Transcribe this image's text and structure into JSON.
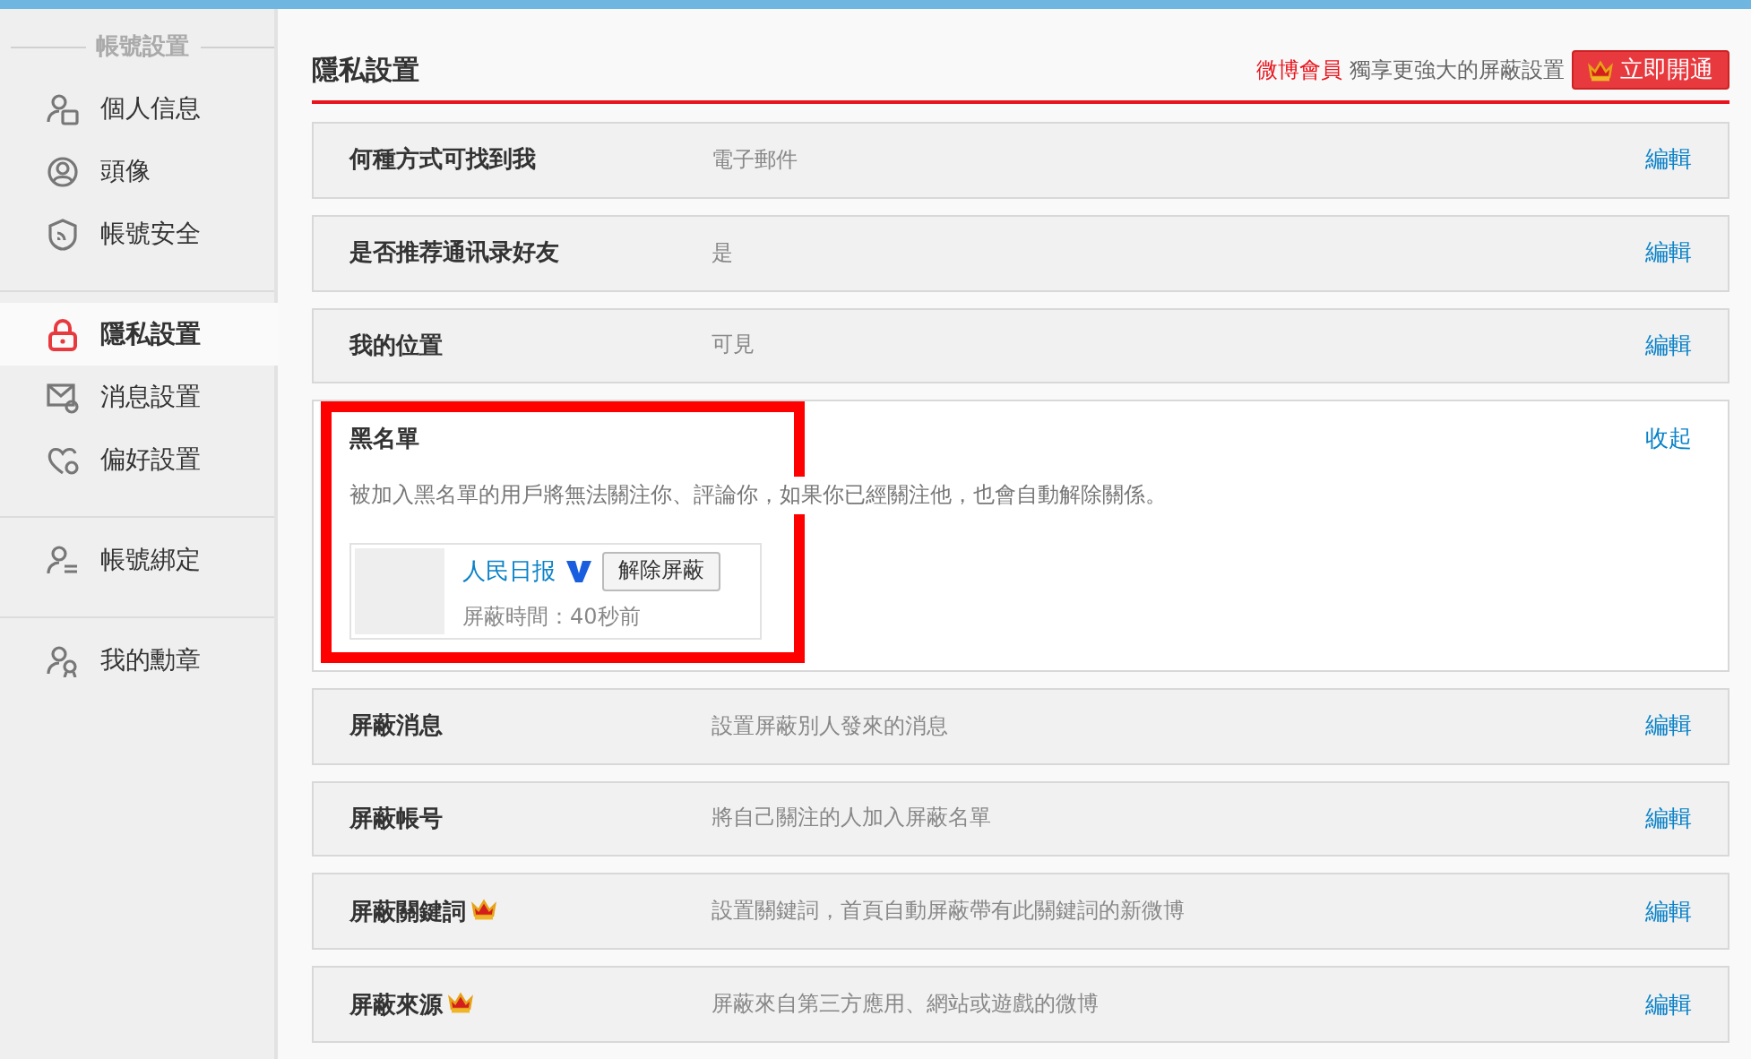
{
  "sidebar": {
    "heading": "帳號設置",
    "groups": [
      {
        "items": [
          {
            "label": "個人信息",
            "selected": false
          },
          {
            "label": "頭像",
            "selected": false
          },
          {
            "label": "帳號安全",
            "selected": false
          }
        ]
      },
      {
        "items": [
          {
            "label": "隱私設置",
            "selected": true
          },
          {
            "label": "消息設置",
            "selected": false
          },
          {
            "label": "偏好設置",
            "selected": false
          }
        ]
      },
      {
        "items": [
          {
            "label": "帳號綁定",
            "selected": false
          }
        ]
      },
      {
        "items": [
          {
            "label": "我的勳章",
            "selected": false
          }
        ]
      }
    ]
  },
  "header": {
    "title": "隱私設置",
    "promo_brand": "微博會員",
    "promo_text": "獨享更強大的屏蔽設置",
    "promo_button": "立即開通"
  },
  "rows_top": [
    {
      "label": "何種方式可找到我",
      "value": "電子郵件",
      "action": "編輯",
      "vip": false
    },
    {
      "label": "是否推荐通讯录好友",
      "value": "是",
      "action": "編輯",
      "vip": false
    },
    {
      "label": "我的位置",
      "value": "可見",
      "action": "編輯",
      "vip": false
    }
  ],
  "blacklist": {
    "title": "黑名單",
    "action": "收起",
    "description": "被加入黑名單的用戶將無法關注你、評論你，如果你已經關注他，也會自動解除關係。",
    "entries": [
      {
        "name": "人民日报",
        "verified": true,
        "button": "解除屏蔽",
        "time_label": "屏蔽時間：",
        "time": "40秒前"
      }
    ]
  },
  "rows_bottom": [
    {
      "label": "屏蔽消息",
      "value": "設置屏蔽別人發來的消息",
      "action": "編輯",
      "vip": false
    },
    {
      "label": "屏蔽帳号",
      "value": "將自己關注的人加入屏蔽名單",
      "action": "編輯",
      "vip": false
    },
    {
      "label": "屏蔽關鍵詞",
      "value": "設置關鍵詞，首頁自動屏蔽帶有此關鍵詞的新微博",
      "action": "編輯",
      "vip": true
    },
    {
      "label": "屏蔽來源",
      "value": "屏蔽來自第三方應用、網站或遊戲的微博",
      "action": "編輯",
      "vip": true
    }
  ]
}
